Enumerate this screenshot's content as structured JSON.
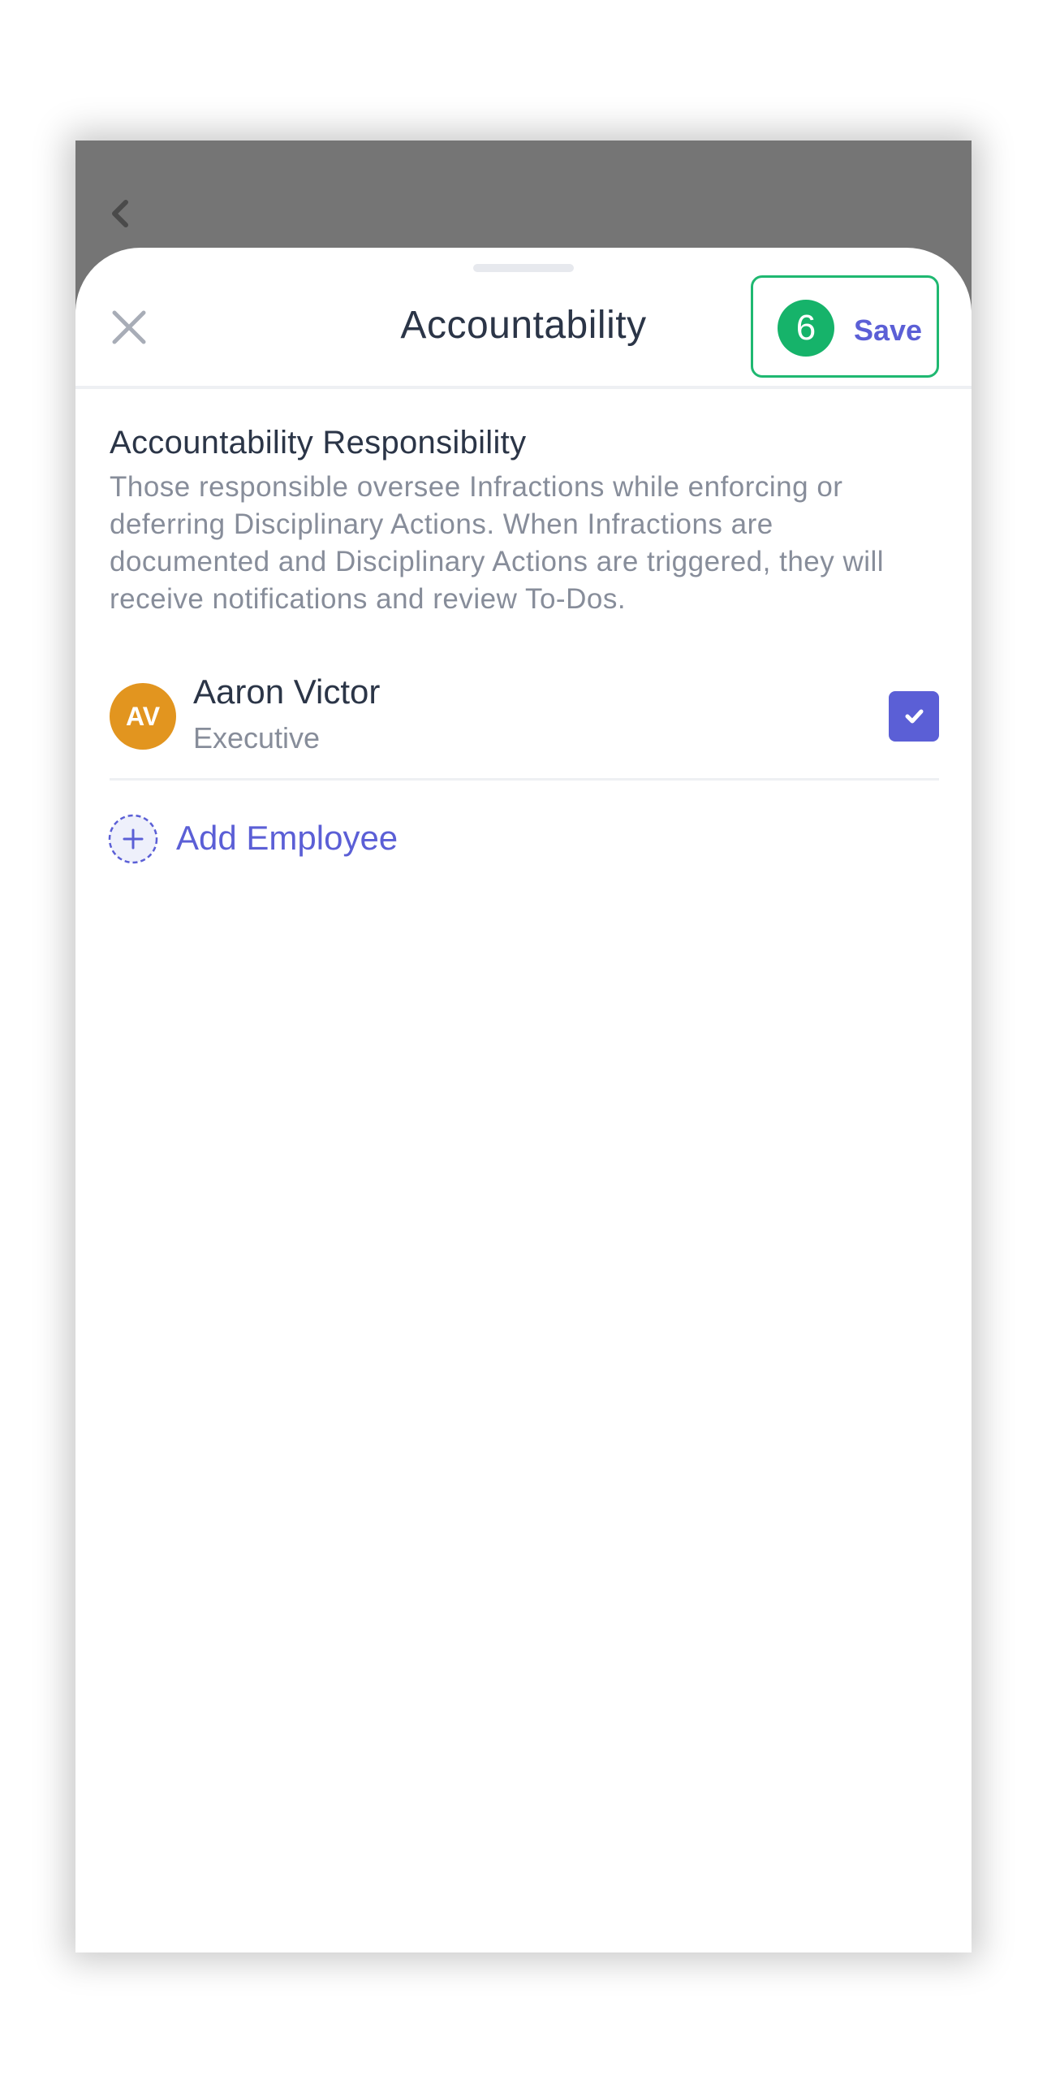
{
  "header": {
    "title": "Accountability",
    "save_label": "Save",
    "save_badge": "6"
  },
  "section": {
    "title": "Accountability Responsibility",
    "description": "Those responsible oversee Infractions while enforcing or deferring Disciplinary Actions. When Infractions are documented and Disciplinary Actions are triggered, they will receive notifications and review To-Dos."
  },
  "employees": [
    {
      "initials": "AV",
      "name": "Aaron Victor",
      "role": "Executive",
      "checked": true,
      "avatar_color": "#E2951F"
    }
  ],
  "add_employee_label": "Add Employee",
  "colors": {
    "accent": "#5B5FD6",
    "save_border": "#1FB871",
    "badge": "#16B36A",
    "backdrop": "#757575"
  },
  "icons": {
    "back": "chevron-left-icon",
    "close": "close-icon",
    "check": "check-icon",
    "add": "plus-circle-icon"
  }
}
